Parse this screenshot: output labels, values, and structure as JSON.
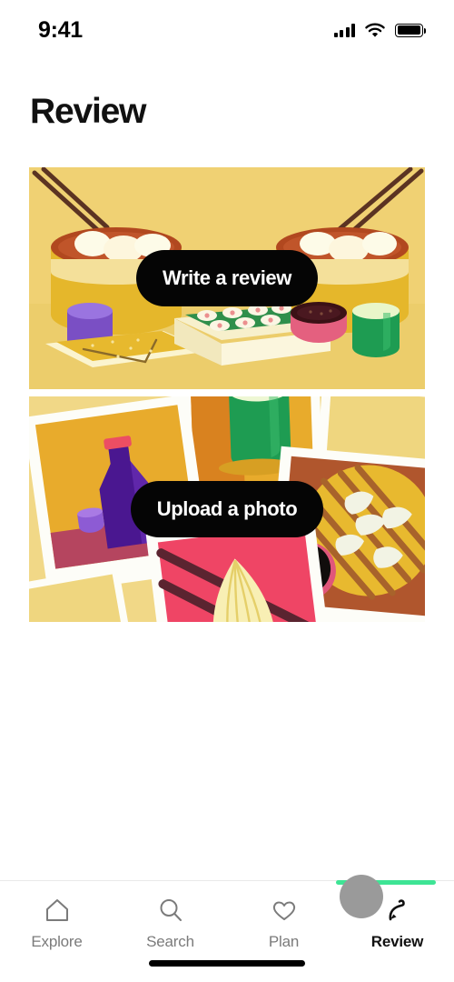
{
  "status_bar": {
    "time": "9:41",
    "signal_icon": "cellular-signal-icon",
    "wifi_icon": "wifi-icon",
    "battery_icon": "battery-full-icon"
  },
  "header": {
    "title": "Review"
  },
  "cards": [
    {
      "id": "write-review",
      "cta_label": "Write a review",
      "background_color": "#f0d173",
      "illustration": "dim-sum-steamers-sushi-table-illustration"
    },
    {
      "id": "upload-photo",
      "cta_label": "Upload a photo",
      "background_color": "#f1d887",
      "illustration": "food-polaroid-photo-collage-illustration"
    }
  ],
  "bottom_nav": {
    "items": [
      {
        "label": "Explore",
        "icon": "home-icon",
        "active": false
      },
      {
        "label": "Search",
        "icon": "search-icon",
        "active": false
      },
      {
        "label": "Plan",
        "icon": "heart-icon",
        "active": false
      },
      {
        "label": "Review",
        "icon": "pen-icon",
        "active": true
      }
    ]
  },
  "overlay": {
    "tap_indicator": "tap-target-circle",
    "progress_color": "#3ee495",
    "progress_percent": 100
  },
  "colors": {
    "accent_green": "#3ee495",
    "cta_background": "#050505",
    "cta_text": "#ffffff",
    "card_yellow": "#f0d173",
    "inactive_tab": "#7b7b7b",
    "active_tab": "#111111"
  }
}
